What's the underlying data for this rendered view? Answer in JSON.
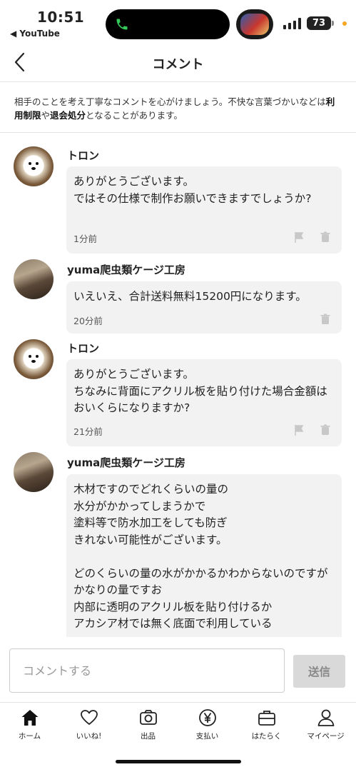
{
  "status_bar": {
    "time": "10:51",
    "back_app": "◀ YouTube",
    "battery": "73",
    "call_color": "#34c759",
    "dot_color": "#f5a623"
  },
  "header": {
    "title": "コメント",
    "back_icon": "chevron-left-icon"
  },
  "notice": {
    "part1": "相手のことを考え丁寧なコメントを心がけましょう。不快な言葉づかいなどは",
    "bold1": "利用制限",
    "part2": "や",
    "bold2": "退会処分",
    "part3": "となることがあります。"
  },
  "comments": [
    {
      "user": "トロン",
      "avatar": "dog-avatar",
      "text": "ありがとうございます。\nではその仕様で制作お願いできますでしょうか?",
      "time": "1分前",
      "show_flag": true
    },
    {
      "user": "yuma爬虫類ケージ工房",
      "avatar": "gecko-avatar",
      "text": "いえいえ、合計送料無料15200円になります。",
      "time": "20分前",
      "show_flag": false
    },
    {
      "user": "トロン",
      "avatar": "dog-avatar",
      "text": "ありがとうございます。\nちなみに背面にアクリル板を貼り付けた場合金額はおいくらになりますか?",
      "time": "21分前",
      "show_flag": true
    },
    {
      "user": "yuma爬虫類ケージ工房",
      "avatar": "gecko-avatar",
      "text": "木材ですのでどれくらいの量の\n水分がかかってしまうかで\n塗料等で防水加工をしても防ぎ\nきれない可能性がございます。\n\nどのくらいの量の水がかかるかわからないのですがかなりの量ですお\n内部に透明のアクリル板を貼り付けるか\nアカシア材では無く底面で利用している",
      "time": "",
      "show_flag": false
    }
  ],
  "composer": {
    "placeholder": "コメントする",
    "send_label": "送信"
  },
  "tabs": [
    {
      "label": "ホーム",
      "icon": "home-icon",
      "active": true
    },
    {
      "label": "いいね!",
      "icon": "heart-icon",
      "active": false
    },
    {
      "label": "出品",
      "icon": "camera-icon",
      "active": false
    },
    {
      "label": "支払い",
      "icon": "yen-icon",
      "active": false
    },
    {
      "label": "はたらく",
      "icon": "briefcase-icon",
      "active": false
    },
    {
      "label": "マイページ",
      "icon": "person-icon",
      "active": false
    }
  ]
}
